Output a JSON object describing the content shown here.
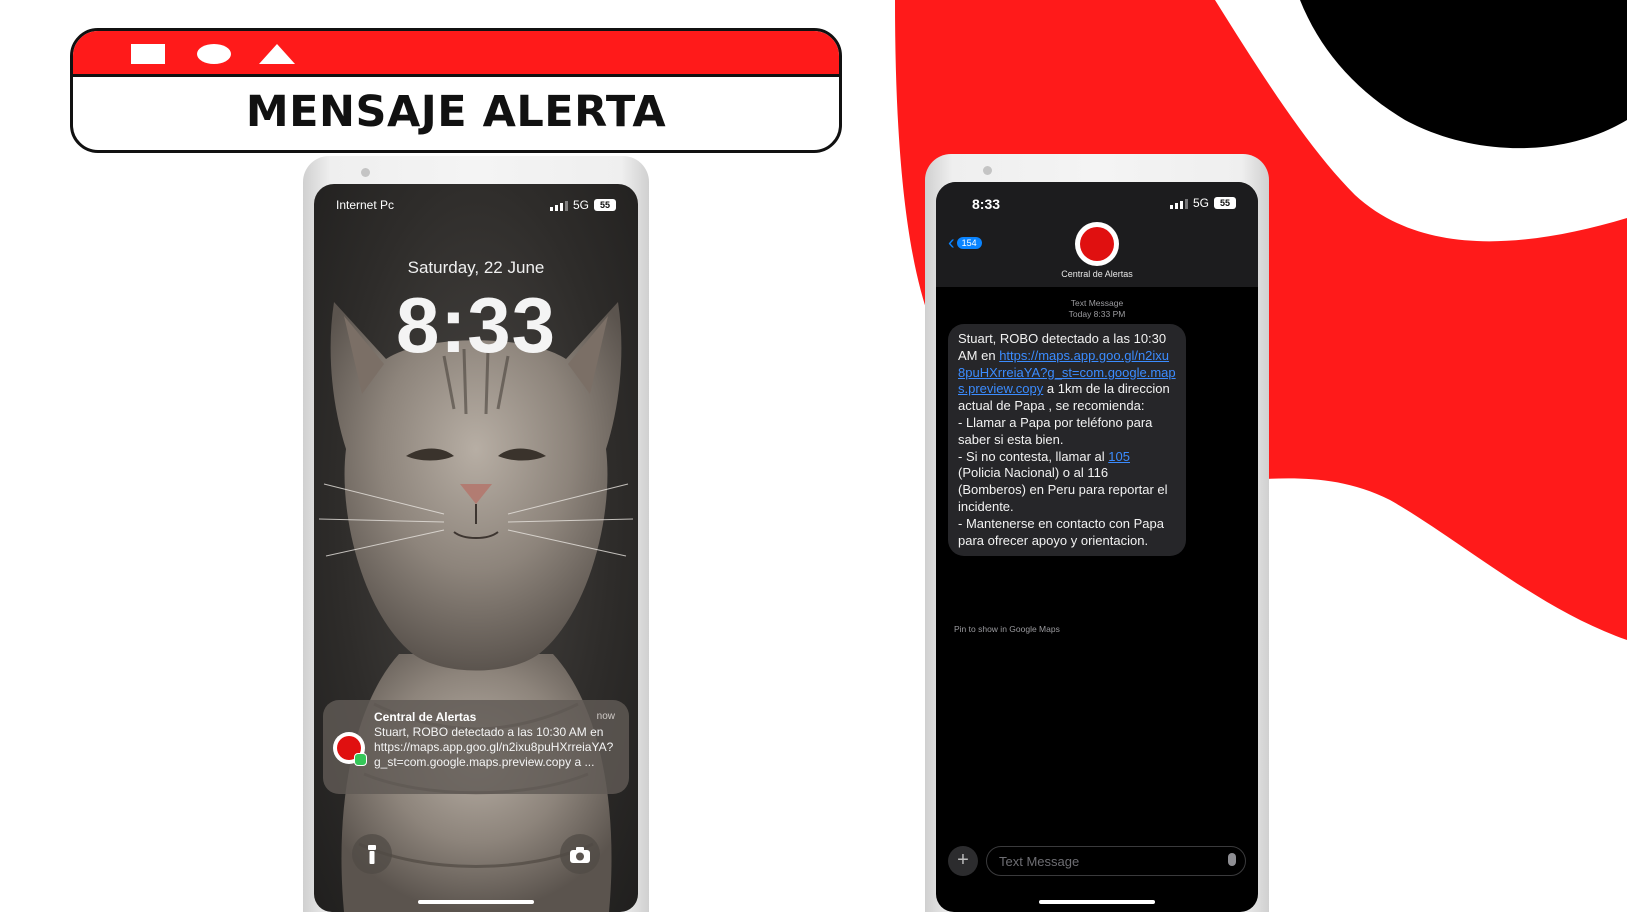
{
  "banner": {
    "title": "MENSAJE ALERTA"
  },
  "lock_screen": {
    "carrier": "Internet Pc",
    "network": "5G",
    "battery": "55",
    "date": "Saturday, 22 June",
    "clock": "8:33",
    "notification": {
      "app": "Central de Alertas",
      "time": "now",
      "body": "Stuart, ROBO  detectado a las 10:30 AM en https://maps.app.goo.gl/n2ixu8puHXrreiaYA?g_st=com.google.maps.preview.copy a ..."
    },
    "flashlight_icon": "flashlight-icon",
    "camera_icon": "camera-icon"
  },
  "messages_screen": {
    "time": "8:33",
    "network": "5G",
    "battery": "55",
    "back_count": "154",
    "contact_name": "Central de Alertas",
    "meta_line1": "Text Message",
    "meta_line2": "Today 8:33 PM",
    "message": {
      "part1": "Stuart, ROBO  detectado a las 10:30 AM en ",
      "link1": "https://maps.app.goo.gl/n2ixu8puHXrreiaYA?g_st=com.google.maps.preview.copy",
      "part2": " a 1km de la direccion actual de Papa , se recomienda:",
      "line1": "- Llamar a Papa por teléfono para saber si esta bien.",
      "line2_a": "- Si no contesta, llamar al ",
      "link2": "105",
      "line2_b": " (Policia Nacional) o al 116 (Bomberos) en Peru para reportar el incidente.",
      "line3": "- Mantenerse en contacto con Papa para ofrecer apoyo y orientacion."
    },
    "pin_hint": "Pin to show in Google Maps",
    "input_placeholder": "Text Message",
    "plus_label": "+"
  },
  "colors": {
    "accent_red": "#ff1a1a",
    "link_blue": "#3b8cff",
    "ios_blue": "#0a84ff"
  }
}
